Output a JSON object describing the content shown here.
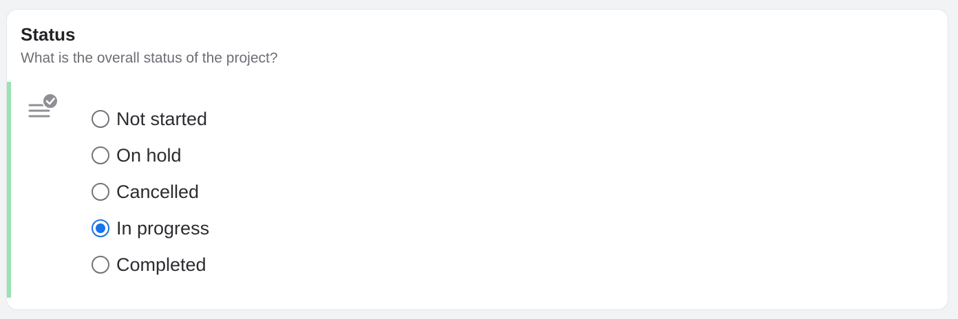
{
  "question": {
    "title": "Status",
    "description": "What is the overall status of the project?",
    "icon": "checklist-icon",
    "accent_color": "#9be3b1",
    "selected_color": "#1a73e8",
    "selected_value": "In progress",
    "options": [
      {
        "label": "Not started",
        "checked": false
      },
      {
        "label": "On hold",
        "checked": false
      },
      {
        "label": "Cancelled",
        "checked": false
      },
      {
        "label": "In progress",
        "checked": true
      },
      {
        "label": "Completed",
        "checked": false
      }
    ]
  }
}
